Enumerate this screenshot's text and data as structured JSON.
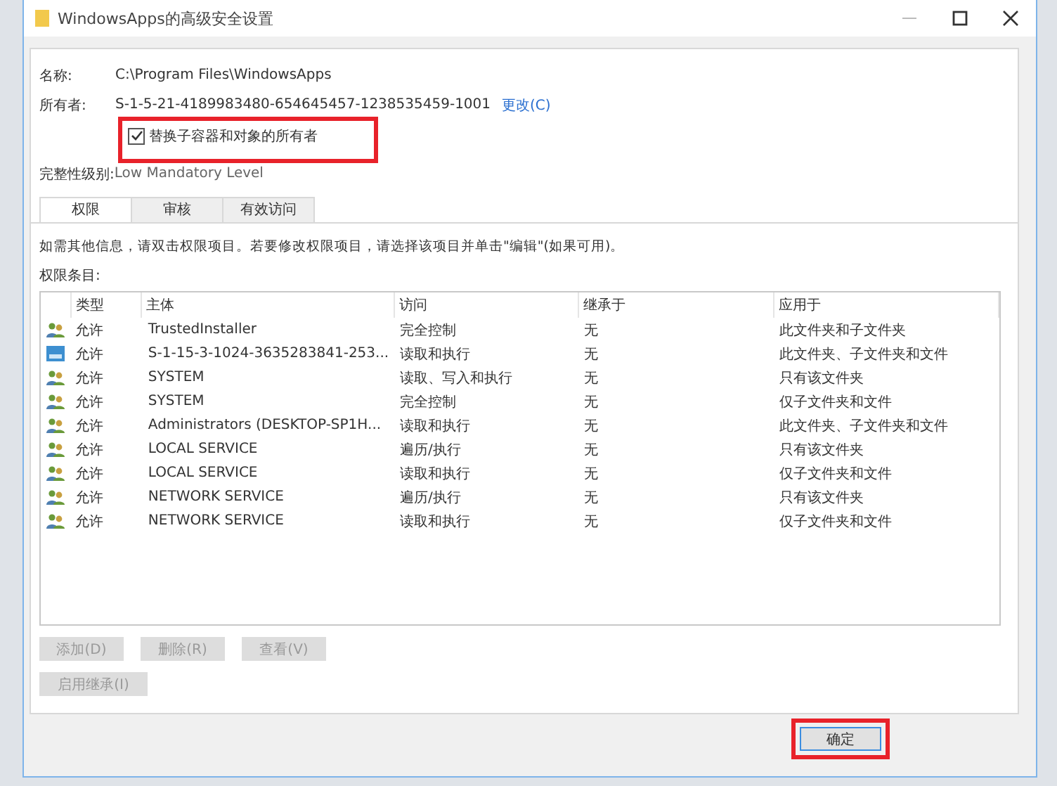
{
  "window": {
    "title": "WindowsApps的高级安全设置"
  },
  "name": {
    "label": "名称:",
    "value": "C:\\Program Files\\WindowsApps"
  },
  "owner": {
    "label": "所有者:",
    "value": "S-1-5-21-4189983480-654645457-1238535459-1001",
    "link": "更改(C)"
  },
  "replace_owner": {
    "label": "替换子容器和对象的所有者",
    "checked": true,
    "highlighted": true
  },
  "integrity": {
    "label": "完整性级别:",
    "value": "Low Mandatory Level"
  },
  "tabs": [
    {
      "label": "权限",
      "selected": true
    },
    {
      "label": "审核",
      "selected": false
    },
    {
      "label": "有效访问",
      "selected": false
    }
  ],
  "hint": "如需其他信息，请双击权限项目。若要修改权限项目，请选择该项目并单击\"编辑\"(如果可用)。",
  "entries_label": "权限条目:",
  "table": {
    "columns": [
      "类型",
      "主体",
      "访问",
      "继承于",
      "应用于"
    ],
    "rows": [
      {
        "kind": "group",
        "cells": [
          "允许",
          "TrustedInstaller",
          "完全控制",
          "无",
          "此文件夹和子文件夹"
        ]
      },
      {
        "kind": "package",
        "cells": [
          "允许",
          "S-1-15-3-1024-3635283841-253...",
          "读取和执行",
          "无",
          "此文件夹、子文件夹和文件"
        ]
      },
      {
        "kind": "group",
        "cells": [
          "允许",
          "SYSTEM",
          "读取、写入和执行",
          "无",
          "只有该文件夹"
        ]
      },
      {
        "kind": "group",
        "cells": [
          "允许",
          "SYSTEM",
          "完全控制",
          "无",
          "仅子文件夹和文件"
        ]
      },
      {
        "kind": "group",
        "cells": [
          "允许",
          "Administrators (DESKTOP-SP1H...",
          "读取和执行",
          "无",
          "此文件夹、子文件夹和文件"
        ]
      },
      {
        "kind": "group",
        "cells": [
          "允许",
          "LOCAL SERVICE",
          "遍历/执行",
          "无",
          "只有该文件夹"
        ]
      },
      {
        "kind": "group",
        "cells": [
          "允许",
          "LOCAL SERVICE",
          "读取和执行",
          "无",
          "仅子文件夹和文件"
        ]
      },
      {
        "kind": "group",
        "cells": [
          "允许",
          "NETWORK SERVICE",
          "遍历/执行",
          "无",
          "只有该文件夹"
        ]
      },
      {
        "kind": "group",
        "cells": [
          "允许",
          "NETWORK SERVICE",
          "读取和执行",
          "无",
          "仅子文件夹和文件"
        ]
      }
    ]
  },
  "buttons": [
    {
      "label": "添加(D)",
      "disabled": true
    },
    {
      "label": "删除(R)",
      "disabled": true
    },
    {
      "label": "查看(V)",
      "disabled": true
    }
  ],
  "inherit_button": {
    "label": "启用继承(I)",
    "disabled": true
  },
  "ok_button": {
    "label": "确定",
    "highlighted": true
  }
}
